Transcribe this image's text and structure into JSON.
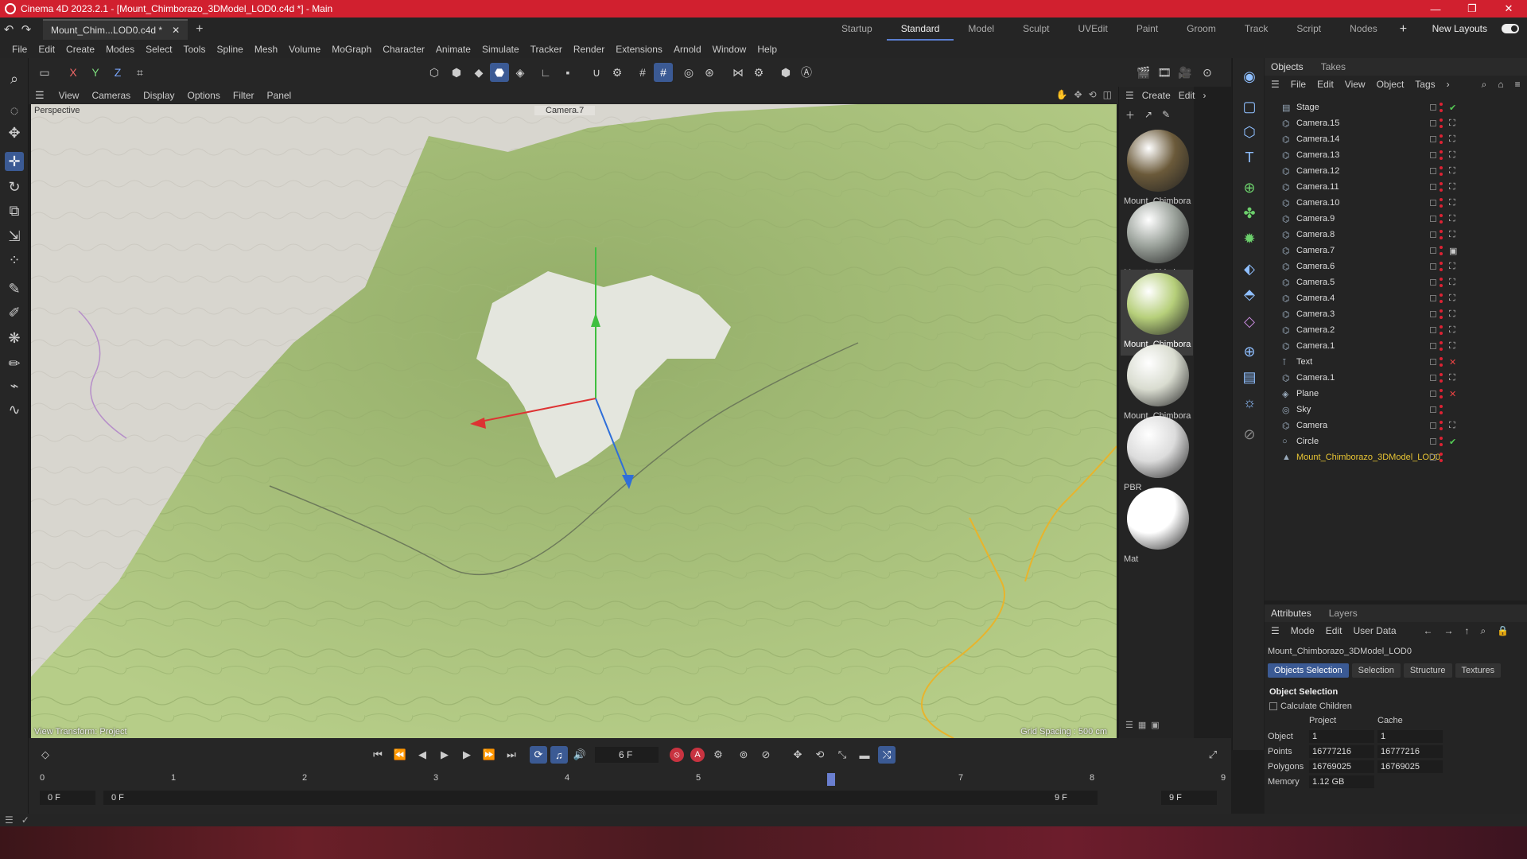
{
  "titlebar": {
    "title": "Cinema 4D 2023.2.1 - [Mount_Chimborazo_3DModel_LOD0.c4d *] - Main",
    "minimize": "—",
    "maximize": "❐",
    "close": "✕"
  },
  "tabbar": {
    "doc_tab": "Mount_Chim...LOD0.c4d *",
    "doc_close": "✕",
    "add_tab": "+",
    "layouts": [
      "Startup",
      "Standard",
      "Model",
      "Sculpt",
      "UVEdit",
      "Paint",
      "Groom",
      "Track",
      "Script",
      "Nodes"
    ],
    "active_layout": "Standard",
    "add_layout": "+",
    "new_layouts": "New Layouts"
  },
  "menubar": [
    "File",
    "Edit",
    "Create",
    "Modes",
    "Select",
    "Tools",
    "Spline",
    "Mesh",
    "Volume",
    "MoGraph",
    "Character",
    "Animate",
    "Simulate",
    "Tracker",
    "Render",
    "Extensions",
    "Arnold",
    "Window",
    "Help"
  ],
  "toolbar": {
    "x": "X",
    "y": "Y",
    "z": "Z"
  },
  "viewport": {
    "menu": [
      "View",
      "Cameras",
      "Display",
      "Options",
      "Filter",
      "Panel"
    ],
    "projection": "Perspective",
    "camera": "Camera.7",
    "view_transform": "View Transform: Project",
    "grid_spacing": "Grid Spacing : 500 cm"
  },
  "materials": {
    "menu": [
      "Create",
      "Edit"
    ],
    "items": [
      {
        "name": "Mount_Chimbora",
        "color": "#6b5a3a"
      },
      {
        "name": "Mount_Chimbora",
        "color": "#9aa19a"
      },
      {
        "name": "Mount_Chimbora",
        "color": "#b6cf7a"
      },
      {
        "name": "Mount_Chimbora",
        "color": "#d9dcd0"
      },
      {
        "name": "PBR",
        "color": "#dcdcdc"
      },
      {
        "name": "Mat",
        "color": "#ffffff"
      }
    ]
  },
  "objects_panel": {
    "tabs": [
      "Objects",
      "Takes"
    ],
    "menu": [
      "File",
      "Edit",
      "View",
      "Object",
      "Tags"
    ],
    "items": [
      {
        "name": "Stage",
        "icon": "stage-icon",
        "tag": "✔"
      },
      {
        "name": "Camera.15",
        "icon": "camera-icon",
        "tag": "⛶"
      },
      {
        "name": "Camera.14",
        "icon": "camera-icon",
        "tag": "⛶"
      },
      {
        "name": "Camera.13",
        "icon": "camera-icon",
        "tag": "⛶"
      },
      {
        "name": "Camera.12",
        "icon": "camera-icon",
        "tag": "⛶"
      },
      {
        "name": "Camera.11",
        "icon": "camera-icon",
        "tag": "⛶"
      },
      {
        "name": "Camera.10",
        "icon": "camera-icon",
        "tag": "⛶"
      },
      {
        "name": "Camera.9",
        "icon": "camera-icon",
        "tag": "⛶"
      },
      {
        "name": "Camera.8",
        "icon": "camera-icon",
        "tag": "⛶"
      },
      {
        "name": "Camera.7",
        "icon": "camera-icon",
        "tag": "▣"
      },
      {
        "name": "Camera.6",
        "icon": "camera-icon",
        "tag": "⛶"
      },
      {
        "name": "Camera.5",
        "icon": "camera-icon",
        "tag": "⛶"
      },
      {
        "name": "Camera.4",
        "icon": "camera-icon",
        "tag": "⛶"
      },
      {
        "name": "Camera.3",
        "icon": "camera-icon",
        "tag": "⛶"
      },
      {
        "name": "Camera.2",
        "icon": "camera-icon",
        "tag": "⛶"
      },
      {
        "name": "Camera.1",
        "icon": "camera-icon",
        "tag": "⛶"
      },
      {
        "name": "Text",
        "icon": "text-icon",
        "tag": "✕"
      },
      {
        "name": "Camera.1",
        "icon": "camera-icon",
        "tag": "⛶"
      },
      {
        "name": "Plane",
        "icon": "plane-icon",
        "tag": "✕"
      },
      {
        "name": "Sky",
        "icon": "sky-icon",
        "tag": ""
      },
      {
        "name": "Camera",
        "icon": "camera-icon",
        "tag": "⛶"
      },
      {
        "name": "Circle",
        "icon": "circle-icon",
        "tag": "✔"
      },
      {
        "name": "Mount_Chimborazo_3DModel_LOD0",
        "icon": "mesh-icon",
        "tag": ""
      }
    ]
  },
  "attributes": {
    "tabs": [
      "Attributes",
      "Layers"
    ],
    "menu": [
      "Mode",
      "Edit",
      "User Data"
    ],
    "path": "Mount_Chimborazo_3DModel_LOD0",
    "subtabs": [
      "Objects Selection",
      "Selection",
      "Structure",
      "Textures"
    ],
    "active_subtab": "Objects Selection",
    "section": "Object Selection",
    "calc_children": "Calculate Children",
    "col_project": "Project",
    "col_cache": "Cache",
    "rows": [
      {
        "label": "Object",
        "project": "1",
        "cache": "1"
      },
      {
        "label": "Points",
        "project": "16777216",
        "cache": "16777216"
      },
      {
        "label": "Polygons",
        "project": "16769025",
        "cache": "16769025"
      },
      {
        "label": "Memory",
        "project": "1.12 GB",
        "cache": ""
      }
    ]
  },
  "timeline": {
    "current_frame": "6 F",
    "ticks": [
      "0",
      "1",
      "2",
      "3",
      "4",
      "5",
      "6",
      "7",
      "8",
      "9"
    ],
    "start": "0 F",
    "range_start": "0 F",
    "range_end": "9 F",
    "end": "9 F",
    "record_label": "A"
  },
  "colors": {
    "accent": "#3b5a94",
    "titlebar": "#d1202f",
    "terrain": "#a9c27e",
    "snow": "#e4e6de",
    "map": "#d8d6cf"
  }
}
